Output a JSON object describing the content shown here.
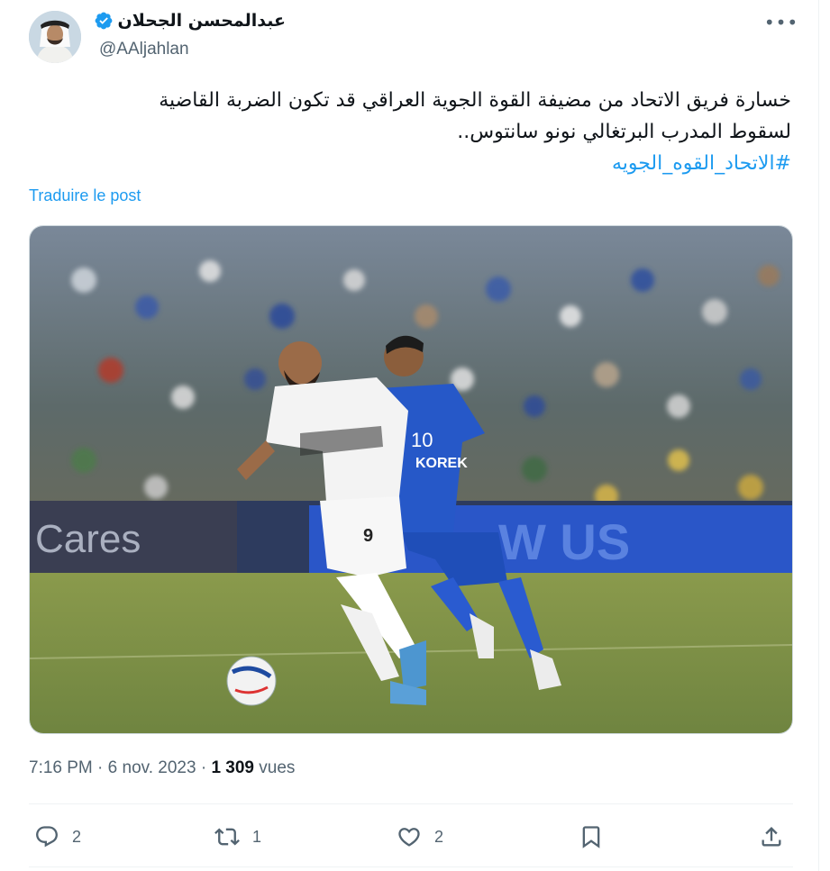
{
  "author": {
    "name": "عبدالمحسن الجحلان",
    "handle": "@AAljahlan",
    "verified": true
  },
  "tweet": {
    "line1": "خسارة فريق الاتحاد من مضيفة القوة الجوية العراقي قد تكون الضربة القاضية",
    "line2": "لسقوط المدرب البرتغالي نونو سانتوس..",
    "hashtag": "#الاتحاد_القوه_الجويه"
  },
  "translate_label": "Traduire le post",
  "media": {
    "icon": "football-match-photo",
    "player_white_number": "9",
    "player_blue_number": "10",
    "sponsor": "KOREK",
    "board_left": "Cares",
    "board_right": "W US"
  },
  "meta": {
    "time": "7:16 PM",
    "sep1": "·",
    "date": "6 nov. 2023",
    "sep2": "·",
    "views_count": "1 309",
    "views_label": "vues"
  },
  "actions": {
    "replies": "2",
    "reposts": "1",
    "likes": "2"
  },
  "colors": {
    "accent": "#1d9bf0",
    "secondary_text": "#536471"
  }
}
